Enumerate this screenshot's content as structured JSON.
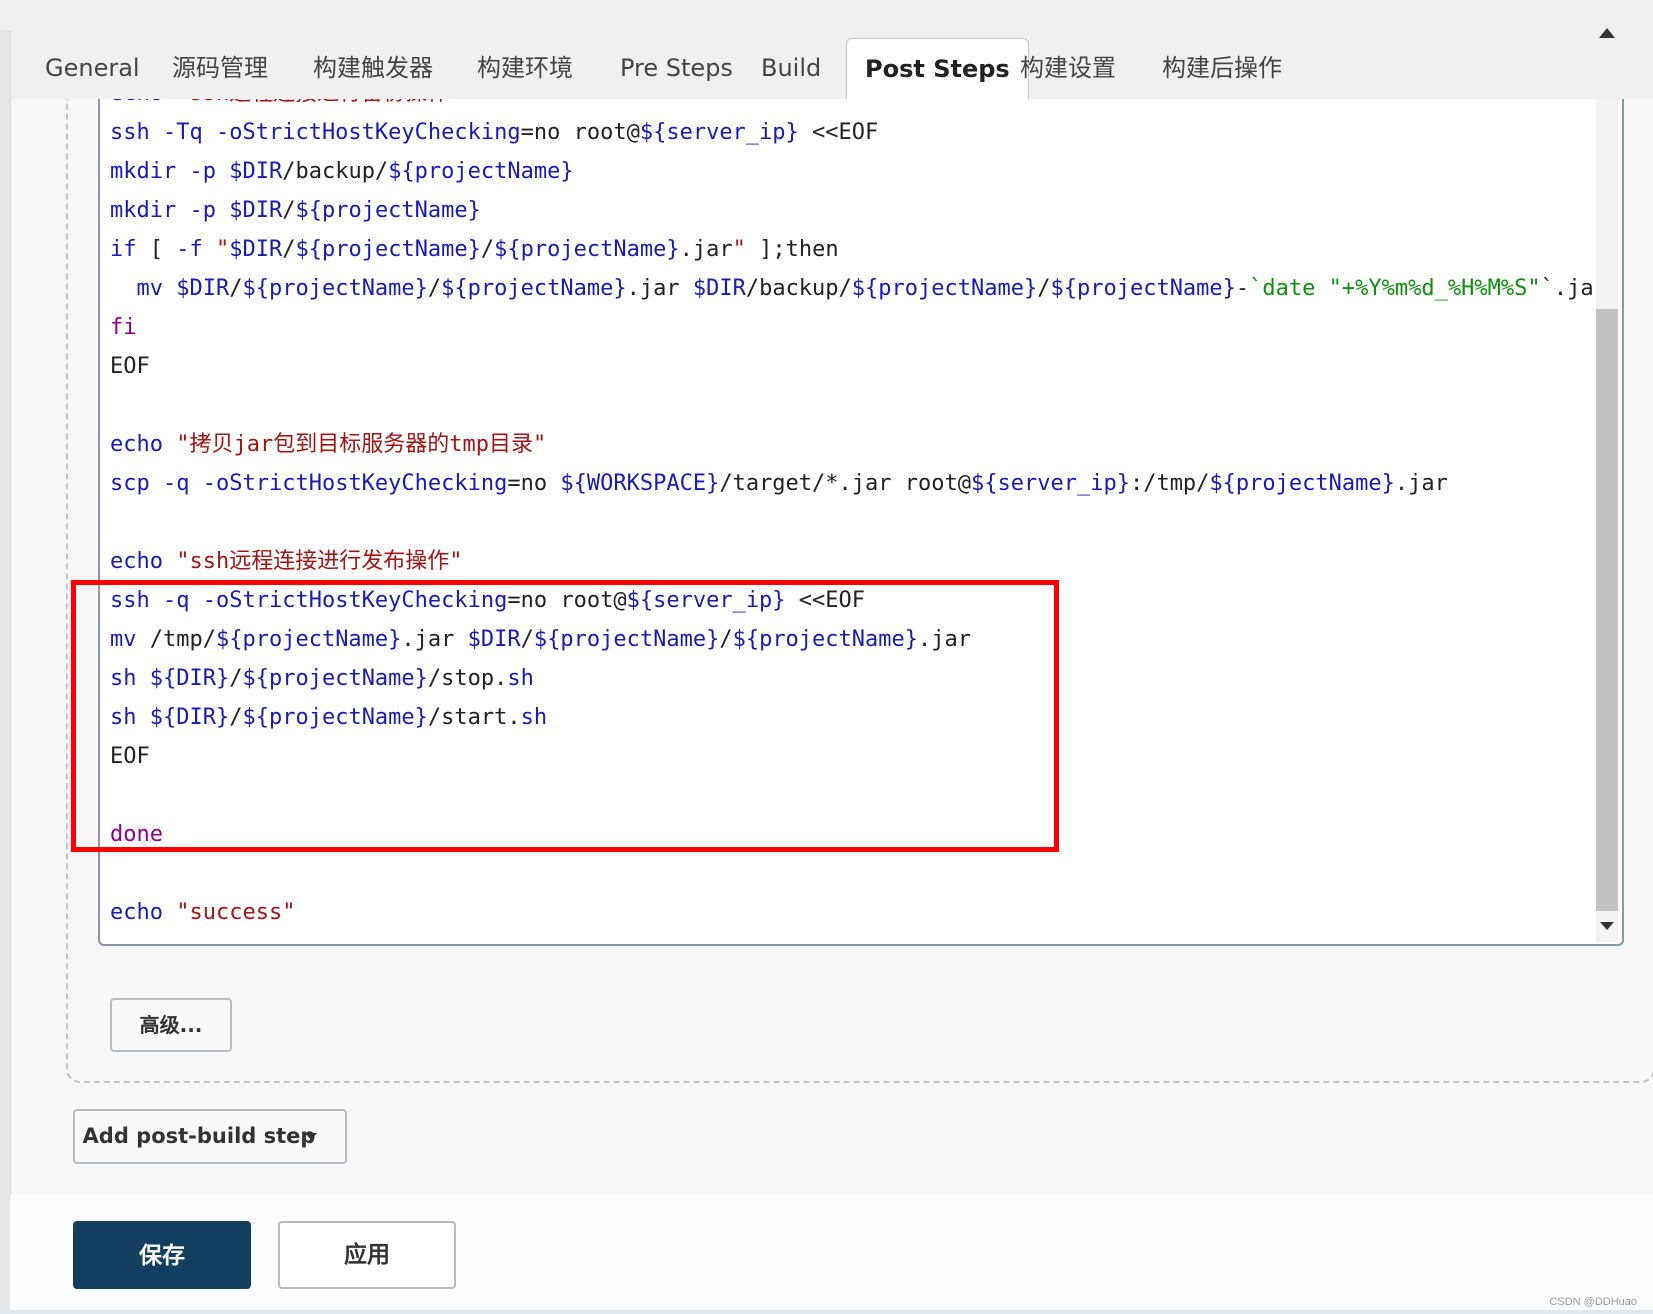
{
  "tabs": [
    {
      "label": "General",
      "active": false
    },
    {
      "label": "源码管理",
      "active": false
    },
    {
      "label": "构建触发器",
      "active": false
    },
    {
      "label": "构建环境",
      "active": false
    },
    {
      "label": "Pre Steps",
      "active": false
    },
    {
      "label": "Build",
      "active": false
    },
    {
      "label": "Post Steps",
      "active": true
    },
    {
      "label": "构建设置",
      "active": false
    },
    {
      "label": "构建后操作",
      "active": false
    }
  ],
  "editor": {
    "lines": [
      "echo \"ssh远程连接进行备份操作\"",
      "ssh -Tq -oStrictHostKeyChecking=no root@${server_ip} <<EOF",
      "mkdir -p $DIR/backup/${projectName}",
      "mkdir -p $DIR/${projectName}",
      "if [ -f \"$DIR/${projectName}/${projectName}.jar\" ];then",
      "  mv $DIR/${projectName}/${projectName}.jar $DIR/backup/${projectName}/${projectName}-`date \"+%Y%m%d_%H%M%S\"`.jar",
      "fi",
      "EOF",
      "",
      "echo \"拷贝jar包到目标服务器的tmp目录\"",
      "scp -q -oStrictHostKeyChecking=no ${WORKSPACE}/target/*.jar root@${server_ip}:/tmp/${projectName}.jar",
      "",
      "echo \"ssh远程连接进行发布操作\"",
      "ssh -q -oStrictHostKeyChecking=no root@${server_ip} <<EOF",
      "mv /tmp/${projectName}.jar $DIR/${projectName}/${projectName}.jar",
      "sh ${DIR}/${projectName}/stop.sh",
      "sh ${DIR}/${projectName}/start.sh",
      "EOF",
      "",
      "done",
      "",
      "echo \"success\""
    ]
  },
  "buttons": {
    "advanced": "高级...",
    "add_post_build_step": "Add post-build step",
    "save": "保存",
    "apply": "应用"
  },
  "watermark": "CSDN @DDHuao",
  "colors": {
    "save_button": "#123f5f",
    "highlight_box": "#ff0000",
    "keyword": "#1a1ab5",
    "string": "#a31515"
  }
}
